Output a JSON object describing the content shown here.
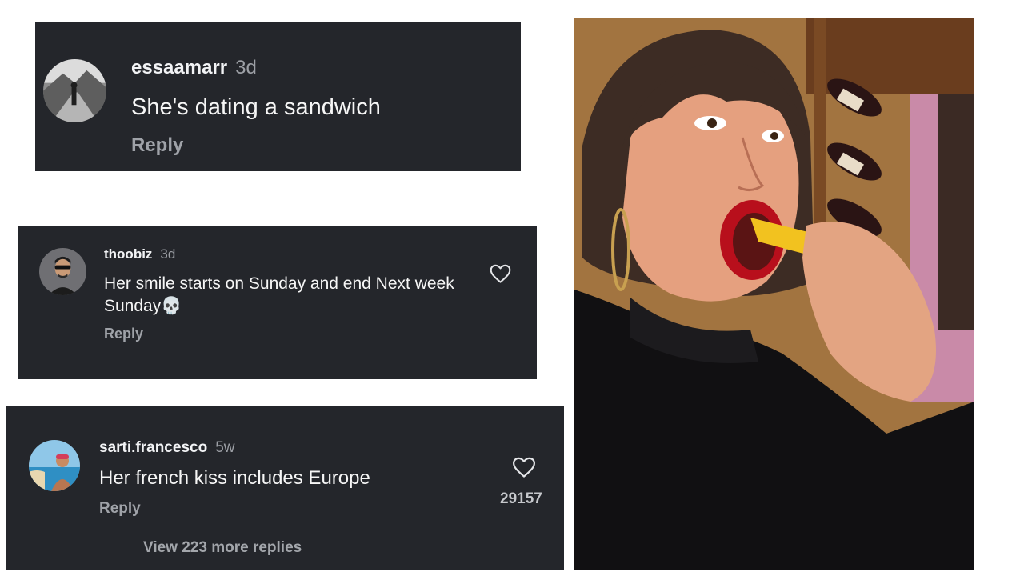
{
  "comments": [
    {
      "username": "essaamarr",
      "age": "3d",
      "text": "She's dating a sandwich",
      "reply_label": "Reply"
    },
    {
      "username": "thoobiz",
      "age": "3d",
      "text": "Her smile starts on Sunday and end Next week Sunday💀",
      "reply_label": "Reply",
      "like_icon": "heart-outline-icon"
    },
    {
      "username": "sarti.francesco",
      "age": "5w",
      "text": "Her french kiss includes Europe",
      "reply_label": "Reply",
      "like_icon": "heart-outline-icon",
      "likes": "29157",
      "view_replies_label": "View 223 more replies"
    }
  ],
  "theme": {
    "card_bg": "#24262b",
    "text": "#f2f3f5",
    "muted": "#9da0a6",
    "page_bg": "#ffffff"
  }
}
